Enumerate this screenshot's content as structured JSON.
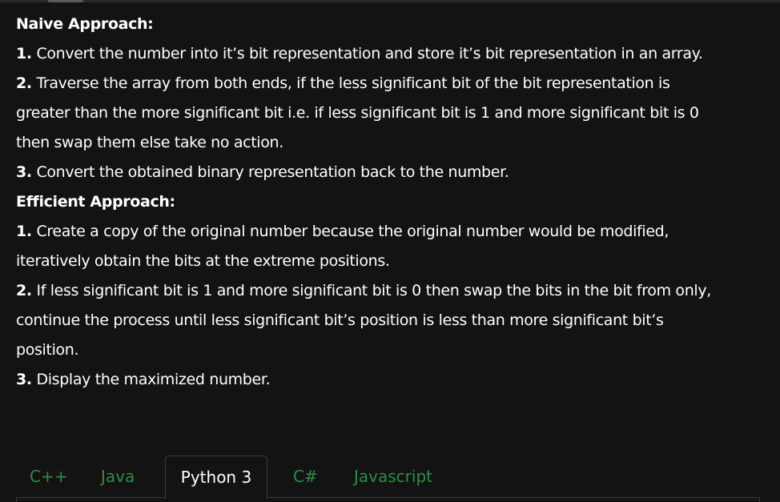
{
  "article": {
    "naive_heading": "Naive Approach:",
    "naive_steps": [
      {
        "num": "1.",
        "text": " Convert the number into it’s bit representation and store it’s bit representation in an array."
      },
      {
        "num": "2.",
        "text": " Traverse the array from both ends, if the less significant bit of the bit representation is"
      },
      {
        "text": "greater than the more significant bit i.e. if less significant bit is 1 and more significant bit is 0"
      },
      {
        "text": "then swap them else take no action."
      },
      {
        "num": "3.",
        "text": " Convert the obtained binary representation back to the number."
      }
    ],
    "efficient_heading": "Efficient Approach:",
    "efficient_steps": [
      {
        "num": "1.",
        "text": " Create a copy of the original number because the original number would be modified,"
      },
      {
        "text": "iteratively obtain the bits at the extreme positions."
      },
      {
        "num": "2.",
        "text": " If less significant bit is 1 and more significant bit is 0 then swap the bits in the bit from only,"
      },
      {
        "text": "continue the process until less significant bit’s position is less than more significant bit’s"
      },
      {
        "text": "position."
      },
      {
        "num": "3.",
        "text": " Display the maximized number."
      }
    ]
  },
  "code_tabs": {
    "active": "Python 3",
    "items": [
      {
        "label": "C++"
      },
      {
        "label": "Java"
      },
      {
        "label": "Python 3"
      },
      {
        "label": "C#"
      },
      {
        "label": "Javascript"
      }
    ]
  },
  "colors": {
    "background": "#131313",
    "text": "#ffffff",
    "tab_link": "#2f8d46",
    "border": "#3c3c3c"
  }
}
